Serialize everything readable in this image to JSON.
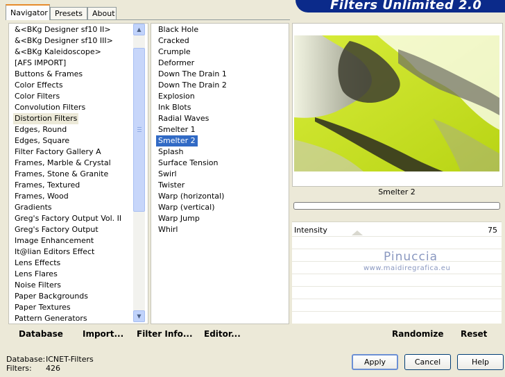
{
  "tabs": [
    "Navigator",
    "Presets",
    "About"
  ],
  "title": "Filters Unlimited 2.0",
  "categories": [
    "&<BKg Designer sf10 II>",
    "&<BKg Designer sf10 III>",
    "&<BKg Kaleidoscope>",
    "[AFS IMPORT]",
    "Buttons & Frames",
    "Color Effects",
    "Color Filters",
    "Convolution Filters",
    "Distortion Filters",
    "Edges, Round",
    "Edges, Square",
    "Filter Factory Gallery A",
    "Frames, Marble & Crystal",
    "Frames, Stone & Granite",
    "Frames, Textured",
    "Frames, Wood",
    "Gradients",
    "Greg's Factory Output Vol. II",
    "Greg's Factory Output",
    "Image Enhancement",
    "It@lian Editors Effect",
    "Lens Effects",
    "Lens Flares",
    "Noise Filters",
    "Paper Backgrounds",
    "Paper Textures",
    "Pattern Generators"
  ],
  "selected_category": "Distortion Filters",
  "filters": [
    "Black Hole",
    "Cracked",
    "Crumple",
    "Deformer",
    "Down The Drain 1",
    "Down The Drain 2",
    "Explosion",
    "Ink Blots",
    "Radial Waves",
    "Smelter 1",
    "Smelter 2",
    "Splash",
    "Surface Tension",
    "Swirl",
    "Twister",
    "Warp (horizontal)",
    "Warp (vertical)",
    "Warp Jump",
    "Whirl"
  ],
  "selected_filter": "Smelter 2",
  "preview": {
    "filter_name": "Smelter 2"
  },
  "params": [
    {
      "label": "Intensity",
      "value": "75"
    }
  ],
  "watermark": {
    "line1": "Pinuccia",
    "line2": "www.maidiregrafica.eu"
  },
  "left_buttons": [
    "Database",
    "Import...",
    "Filter Info...",
    "Editor..."
  ],
  "right_buttons": [
    "Randomize",
    "Reset"
  ],
  "info": {
    "database_label": "Database:",
    "database_value": "ICNET-Filters",
    "filters_label": "Filters:",
    "filters_value": "426"
  },
  "dialog_buttons": {
    "apply": "Apply",
    "cancel": "Cancel",
    "help": "Help"
  },
  "colors": {
    "accent": "#316ac5",
    "banner": "#0b2a8a",
    "preview_lime": "#c8e01c",
    "preview_dark": "#3a3a2a"
  }
}
